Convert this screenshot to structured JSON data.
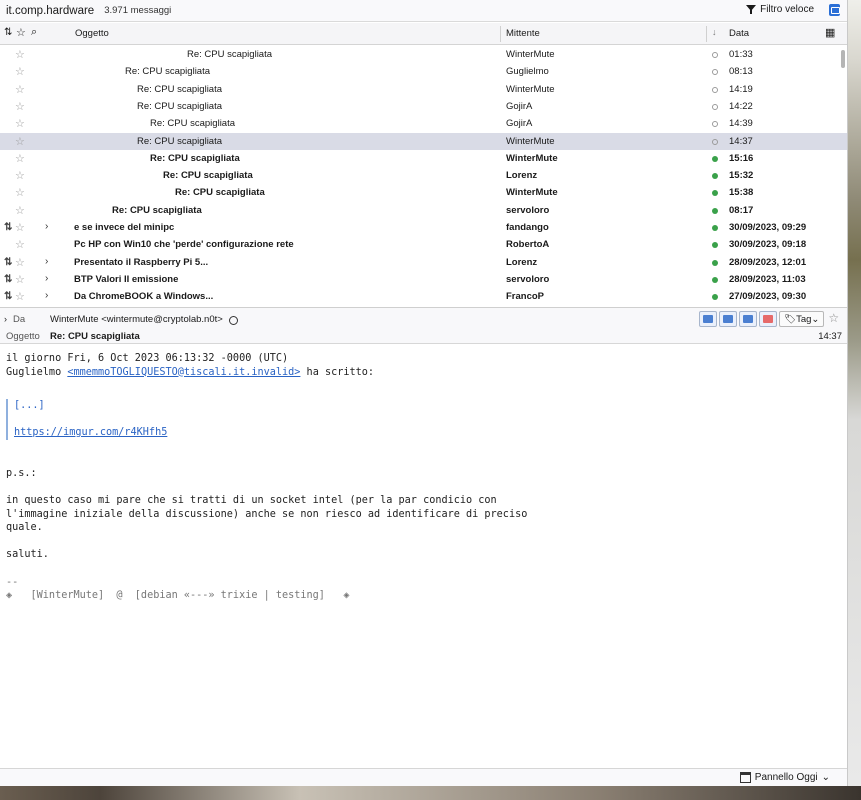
{
  "folder": {
    "name": "it.comp.hardware",
    "count": "3.971 messaggi",
    "quick_filter": "Filtro veloce"
  },
  "columns": {
    "subject": "Oggetto",
    "sender": "Mittente",
    "date": "Data"
  },
  "messages": [
    {
      "subject": "Re: CPU scapigliata",
      "sender": "WinterMute",
      "date": "01:33",
      "indent": 187,
      "status": "read"
    },
    {
      "subject": "Re: CPU scapigliata",
      "sender": "Guglielmo",
      "date": "08:13",
      "indent": 125,
      "status": "read"
    },
    {
      "subject": "Re: CPU scapigliata",
      "sender": "WinterMute",
      "date": "14:19",
      "indent": 137,
      "status": "read"
    },
    {
      "subject": "Re: CPU scapigliata",
      "sender": "GojirA",
      "date": "14:22",
      "indent": 137,
      "status": "read"
    },
    {
      "subject": "Re: CPU scapigliata",
      "sender": "GojirA",
      "date": "14:39",
      "indent": 150,
      "status": "read"
    },
    {
      "subject": "Re: CPU scapigliata",
      "sender": "WinterMute",
      "date": "14:37",
      "indent": 137,
      "status": "read",
      "selected": true
    },
    {
      "subject": "Re: CPU scapigliata",
      "sender": "WinterMute",
      "date": "15:16",
      "indent": 150,
      "status": "new"
    },
    {
      "subject": "Re: CPU scapigliata",
      "sender": "Lorenz",
      "date": "15:32",
      "indent": 163,
      "status": "new"
    },
    {
      "subject": "Re: CPU scapigliata",
      "sender": "WinterMute",
      "date": "15:38",
      "indent": 175,
      "status": "new"
    },
    {
      "subject": "Re: CPU scapigliata",
      "sender": "servoloro",
      "date": "08:17",
      "indent": 112,
      "status": "new"
    },
    {
      "subject": "e se invece del minipc",
      "sender": "fandango",
      "date": "30/09/2023, 09:29",
      "indent": 74,
      "status": "new",
      "thread": true,
      "twisty": true
    },
    {
      "subject": "Pc HP con Win10 che 'perde' configurazione rete",
      "sender": "RobertoA",
      "date": "30/09/2023, 09:18",
      "indent": 74,
      "status": "new"
    },
    {
      "subject": "Presentato il Raspberry Pi 5...",
      "sender": "Lorenz",
      "date": "28/09/2023, 12:01",
      "indent": 74,
      "status": "new",
      "thread": true,
      "twisty": true
    },
    {
      "subject": "BTP Valori II emissione",
      "sender": "servoloro",
      "date": "28/09/2023, 11:03",
      "indent": 74,
      "status": "new",
      "thread": true,
      "twisty": true
    },
    {
      "subject": "Da ChromeBOOK a Windows...",
      "sender": "FrancoP",
      "date": "27/09/2023, 09:30",
      "indent": 74,
      "status": "new",
      "thread": true,
      "twisty": true
    }
  ],
  "header": {
    "from_label": "Da",
    "from_value": "WinterMute <wintermute@cryptolab.n0t>",
    "subject_label": "Oggetto",
    "subject_value": "Re: CPU scapigliata",
    "time": "14:37",
    "tag_label": "Tag"
  },
  "body": {
    "intro1": "il giorno Fri, 6 Oct 2023 06:13:32 -0000 (UTC)",
    "intro2_prefix": "Guglielmo ",
    "intro2_email": "<mmemmoTOGLIQUESTO@tiscali.it.invalid>",
    "intro2_suffix": " ha scritto:",
    "quote1": "[...]",
    "quote_link": "https://imgur.com/r4KHfh5",
    "ps": "p.s.:",
    "para1": "in questo caso mi pare che si tratti di un socket intel (per la par condicio con",
    "para2": "l'immagine iniziale della discussione) anche se non riesco ad identificare di preciso",
    "para3": "quale.",
    "saluti": "saluti.",
    "sig_sep": "--",
    "sig": "◈   [WinterMute]  @  [debian «---» trixie | testing]   ◈"
  },
  "statusbar": {
    "today_pane": "Pannello Oggi"
  },
  "icons": {
    "star": "star-icon",
    "thread": "thread-icon",
    "attachment": "paperclip-icon",
    "filter": "filter-icon",
    "calendar": "calendar-icon"
  }
}
